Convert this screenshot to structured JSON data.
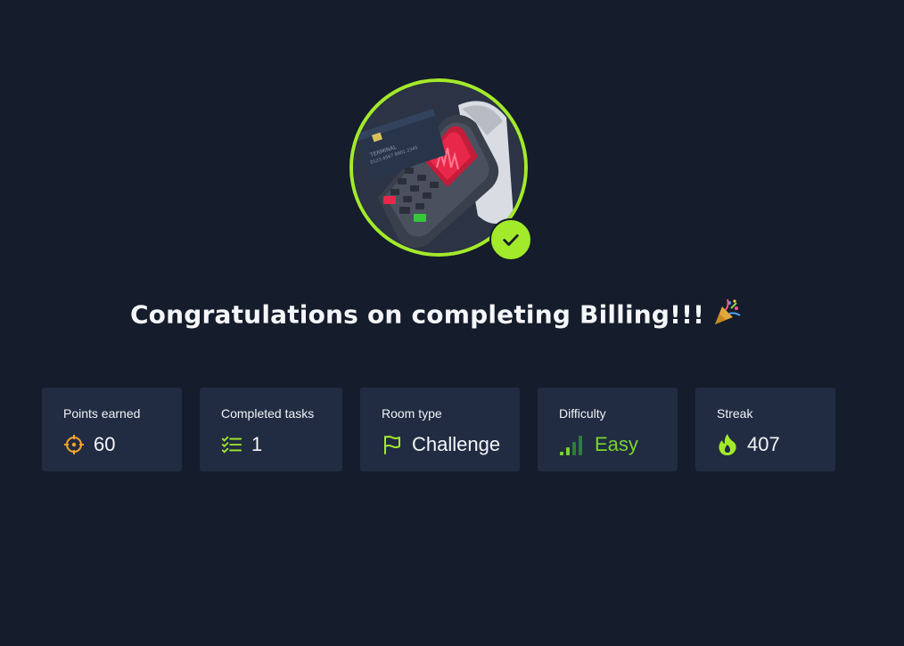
{
  "room": {
    "title": "Congratulations on completing Billing!!!",
    "emoji": "party-popper-icon"
  },
  "badge": {
    "icon": "payment-terminal-badge",
    "completed_icon": "checkmark-icon",
    "ring_color": "#a3ea2a"
  },
  "stats": [
    {
      "label": "Points earned",
      "value": "60",
      "icon": "crosshair-icon",
      "icon_color": "#f5a623"
    },
    {
      "label": "Completed tasks",
      "value": "1",
      "icon": "checklist-icon",
      "icon_color": "#a3ea2a"
    },
    {
      "label": "Room type",
      "value": "Challenge",
      "icon": "flag-icon",
      "icon_color": "#a3ea2a"
    },
    {
      "label": "Difficulty",
      "value": "Easy",
      "icon": "signal-bars-icon",
      "icon_color": "#7bd331"
    },
    {
      "label": "Streak",
      "value": "407",
      "icon": "flame-icon",
      "icon_color": "#a3ea2a"
    }
  ]
}
